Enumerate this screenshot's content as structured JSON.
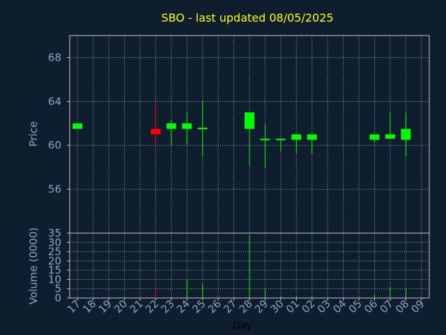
{
  "chart_data": {
    "type": "candlestick",
    "title": "SBO - last updated 08/05/2025",
    "xlabel": "Day",
    "x_tick_labels": [
      "17",
      "18",
      "19",
      "20",
      "21",
      "22",
      "23",
      "24",
      "25",
      "26",
      "27",
      "28",
      "29",
      "30",
      "01",
      "02",
      "03",
      "04",
      "05",
      "06",
      "07",
      "08",
      "09"
    ],
    "price_panel": {
      "ylabel": "Price",
      "ylim": [
        52,
        70
      ],
      "yticks": [
        56,
        60,
        64,
        68
      ],
      "grid": true
    },
    "volume_panel": {
      "ylabel": "Volume (0000)",
      "ylim": [
        0,
        35
      ],
      "yticks": [
        0,
        5,
        10,
        15,
        20,
        25,
        30,
        35
      ],
      "grid": true
    },
    "candles": [
      {
        "day": "17",
        "open": 61.5,
        "high": 62.0,
        "low": 61.5,
        "close": 62.0,
        "volume": 0
      },
      {
        "day": "22",
        "open": 61.5,
        "high": 64.0,
        "low": 60.0,
        "close": 61.0,
        "volume": 5
      },
      {
        "day": "23",
        "open": 61.5,
        "high": 62.3,
        "low": 60.0,
        "close": 62.0,
        "volume": 0
      },
      {
        "day": "24",
        "open": 61.5,
        "high": 63.0,
        "low": 60.0,
        "close": 62.0,
        "volume": 10
      },
      {
        "day": "25",
        "open": 61.5,
        "high": 64.0,
        "low": 59.0,
        "close": 61.6,
        "volume": 8
      },
      {
        "day": "28",
        "open": 61.5,
        "high": 63.0,
        "low": 58.2,
        "close": 63.0,
        "volume": 34
      },
      {
        "day": "29",
        "open": 60.5,
        "high": 62.0,
        "low": 58.0,
        "close": 60.6,
        "volume": 5
      },
      {
        "day": "30",
        "open": 60.5,
        "high": 60.6,
        "low": 59.5,
        "close": 60.6,
        "volume": 1
      },
      {
        "day": "01",
        "open": 60.5,
        "high": 61.0,
        "low": 59.2,
        "close": 61.0,
        "volume": 1
      },
      {
        "day": "02",
        "open": 60.5,
        "high": 61.0,
        "low": 59.2,
        "close": 61.0,
        "volume": 1
      },
      {
        "day": "06",
        "open": 60.5,
        "high": 61.0,
        "low": 60.2,
        "close": 61.0,
        "volume": 2
      },
      {
        "day": "07",
        "open": 60.6,
        "high": 63.0,
        "low": 60.6,
        "close": 61.0,
        "volume": 6
      },
      {
        "day": "08",
        "open": 60.5,
        "high": 63.0,
        "low": 59.0,
        "close": 61.5,
        "volume": 5
      }
    ],
    "colors": {
      "background": "#0f1e2f",
      "up": "#00ff00",
      "down": "#ff0000",
      "grid": "#d8d8d8",
      "axis": "#c8c8c8",
      "text": "#8fa3c6",
      "title": "#ffff00",
      "xlabel": "#000000"
    }
  }
}
